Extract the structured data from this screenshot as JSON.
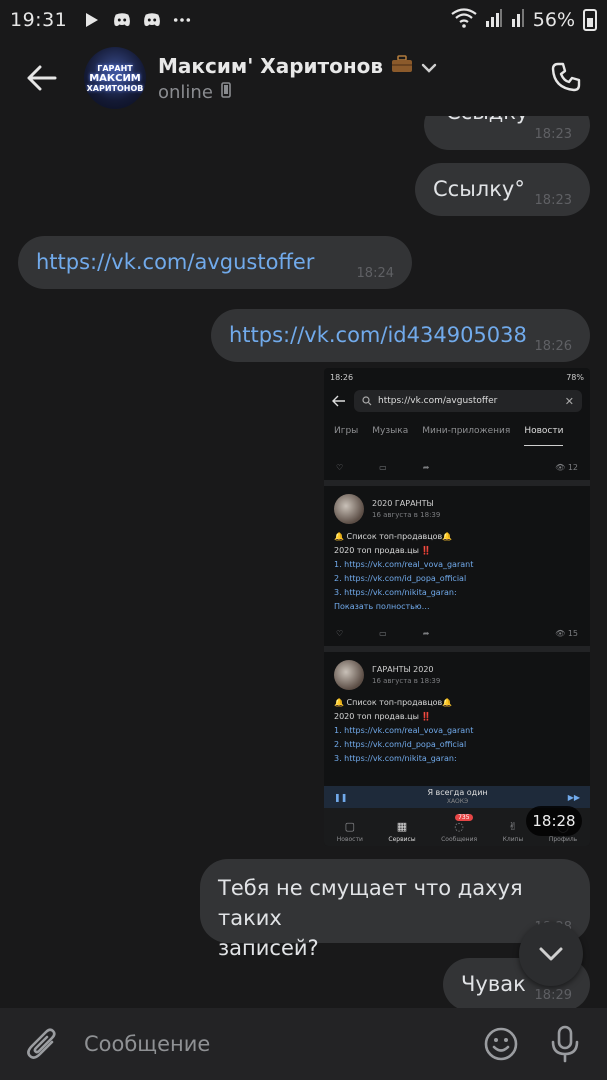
{
  "status_bar": {
    "time": "19:31",
    "battery": "56%"
  },
  "header": {
    "contact_name": "Максим' Харитонов",
    "contact_status": "online",
    "avatar_text_top": "ГАРАНТ",
    "avatar_text_mid": "МАКСИМ",
    "avatar_text_bot": "ХАРИТОНОВ"
  },
  "messages": [
    {
      "text": "Ссыдку",
      "time": "18:23",
      "outgoing": true
    },
    {
      "text": "Ссылку°",
      "time": "18:23",
      "outgoing": true
    },
    {
      "text": "https://vk.com/avgustoffer",
      "time": "18:24",
      "outgoing": false
    },
    {
      "text": "https://vk.com/id434905038",
      "time": "18:26",
      "outgoing": true
    },
    {
      "text": "Тебя не смущает что дахуя таких записей?",
      "line1": "Тебя не смущает что дахуя таких",
      "line2": "записей?",
      "time": "18:28",
      "outgoing": true
    },
    {
      "text": "Чувак",
      "time": "18:29",
      "outgoing": true
    }
  ],
  "image_message": {
    "time": "18:28",
    "statusbar_time": "18:26",
    "statusbar_battery": "78%",
    "url": "https://vk.com/avgustoffer",
    "tabs": [
      "Игры",
      "Музыка",
      "Мини-приложения",
      "Новости"
    ],
    "views_1": "12",
    "views_2": "15",
    "posts": [
      {
        "author": "2020 ГАРАНТЫ",
        "date": "16 августа в 18:39",
        "line1": "🔔 Список топ-продавцов🔔",
        "line2": "2020 топ продав.цы ‼️",
        "link1": "1. https://vk.com/real_vova_garant",
        "link2": "2. https://vk.com/id_popa_official",
        "link3": "3. https://vk.com/nikita_garan:",
        "more": "Показать полностью…"
      },
      {
        "author": "ГАРАНТЫ 2020",
        "date": "16 августа в 18:39",
        "line1": "🔔 Список топ-продавцов🔔",
        "line2": "2020 топ продав.цы ‼️",
        "link1": "1. https://vk.com/real_vova_garant",
        "link2": "2. https://vk.com/id_popa_official",
        "link3": "3. https://vk.com/nikita_garan:"
      }
    ],
    "player_track": "Я всегда один",
    "player_artist": "ХАОКЭ",
    "nav": [
      "Новости",
      "Сервисы",
      "Сообщения",
      "Клипы",
      "Профиль"
    ],
    "messages_badge": "735"
  },
  "input": {
    "placeholder": "Сообщение"
  },
  "colors": {
    "background": "#19191a",
    "bubble": "#333436",
    "link": "#71aaeb",
    "input_bar": "#232325"
  }
}
